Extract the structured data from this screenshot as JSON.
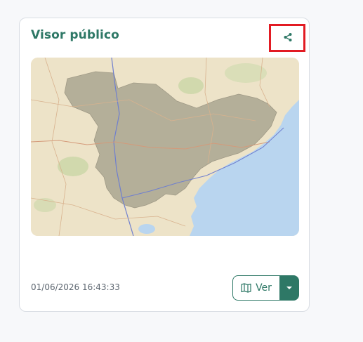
{
  "card": {
    "title": "Visor público",
    "timestamp": "01/06/2026 16:43:33",
    "share_icon": "share-icon",
    "map_icon": "map-icon",
    "view_button_label": "Ver",
    "dropdown_icon": "caret-down-icon"
  },
  "colors": {
    "accent": "#2e7866",
    "highlight": "#e21b23",
    "sea": "#b9d5ef",
    "land": "#ede3c8",
    "region": "#a8a48f"
  }
}
